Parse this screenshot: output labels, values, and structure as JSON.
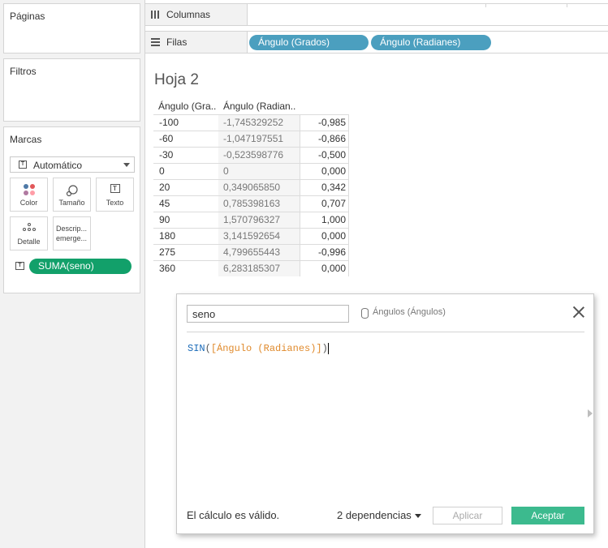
{
  "left_panel": {
    "paginas": "Páginas",
    "filtros": "Filtros",
    "marcas": "Marcas",
    "mark_type": "Automático",
    "buttons": {
      "color": "Color",
      "tamano": "Tamaño",
      "texto": "Texto",
      "detalle": "Detalle",
      "descripcion_1": "Descrip...",
      "descripcion_2": "emerge..."
    },
    "suma_pill": "SUMA(seno)"
  },
  "shelves": {
    "columnas": "Columnas",
    "filas": "Filas",
    "filas_pills": [
      "Ángulo (Grados)",
      "Ángulo (Radianes)"
    ]
  },
  "sheet": {
    "title": "Hoja 2",
    "headers": [
      "Ángulo (Gra..",
      "Ángulo (Radian.."
    ],
    "rows": [
      [
        "-100",
        "-1,745329252",
        "-0,985"
      ],
      [
        "-60",
        "-1,047197551",
        "-0,866"
      ],
      [
        "-30",
        "-0,523598776",
        "-0,500"
      ],
      [
        "0",
        "0",
        "0,000"
      ],
      [
        "20",
        "0,349065850",
        "0,342"
      ],
      [
        "45",
        "0,785398163",
        "0,707"
      ],
      [
        "90",
        "1,570796327",
        "1,000"
      ],
      [
        "180",
        "3,141592654",
        "0,000"
      ],
      [
        "275",
        "4,799655443",
        "-0,996"
      ],
      [
        "360",
        "6,283185307",
        "0,000"
      ]
    ]
  },
  "dialog": {
    "calc_name": "seno",
    "datasource": "Ángulos (Ángulos)",
    "formula_fn": "SIN",
    "formula_open": "(",
    "formula_field": "[Ángulo (Radianes)]",
    "formula_close": ")",
    "status": "El cálculo es válido.",
    "dependencies": "2 dependencias",
    "apply": "Aplicar",
    "ok": "Aceptar"
  },
  "colors": {
    "blue_pill": "#4b9fbf",
    "green_pill": "#12a06a",
    "ok_button": "#3cba8e",
    "formula_fn": "#1a6ab8",
    "formula_field": "#e08a2c"
  }
}
